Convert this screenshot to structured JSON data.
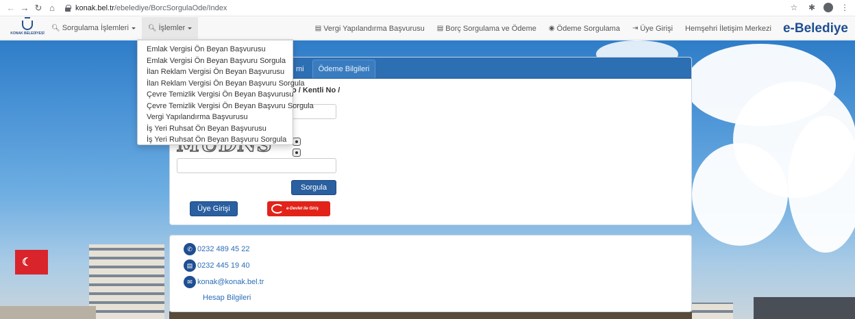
{
  "browser": {
    "url_host": "konak.bel.tr",
    "url_path": "/ebelediye/BorcSorgulaOde/Index",
    "icons": [
      "back-arrow-icon",
      "forward-arrow-icon",
      "reload-icon",
      "home-icon",
      "lock-icon",
      "star-icon",
      "extensions-icon",
      "profile-icon",
      "menu-icon"
    ]
  },
  "navbar": {
    "logo_text": "KONAK BELEDİYESİ",
    "menu_sorgulama": "Sorgulama İşlemleri",
    "menu_islemler": "İşlemler",
    "link_vergi": "Vergi Yapılandırma Başvurusu",
    "link_borc": "Borç Sorgulama ve Ödeme",
    "link_odeme_sorgulama": "Ödeme Sorgulama",
    "link_uye_girisi": "Üye Girişi",
    "link_hemsehri": "Hemşehri İletişim Merkezi",
    "brand": "e-Belediye"
  },
  "dropdown": {
    "items": [
      "Emlak Vergisi Ön Beyan Başvurusu",
      "Emlak Vergisi Ön Beyan Başvuru Sorgula",
      "İlan Reklam Vergisi Ön Beyan Başvurusu",
      "İlan Reklam Vergisi Ön Beyan Başvuru Sorgula",
      "Çevre Temizlik Vergisi Ön Beyan Başvurusu",
      "Çevre Temizlik Vergisi Ön Beyan Başvuru Sorgula",
      "Vergi Yapılandırma Başvurusu",
      "İş Yeri Ruhsat Ön Beyan Başvurusu",
      "İş Yeri Ruhsat Ön Beyan Başvuru Sorgula"
    ]
  },
  "panel": {
    "tab_partial": "mi",
    "tab_odeme": "Ödeme Bilgileri",
    "form_label_partial": "o / Kentli No /",
    "captcha_text": "MUDNS",
    "sorgula_button": "Sorgula",
    "uye_girisi_button": "Üye Girişi",
    "edevlet_button": "e-Devlet ile Giriş"
  },
  "contact": {
    "phone": "0232 489 45 22",
    "fax": "0232 445 19 40",
    "email": "konak@konak.bel.tr",
    "hesap": "Hesap Bilgileri"
  },
  "colors": {
    "brand": "#1f4e92",
    "panel_header": "#2d6fb3",
    "primary_button": "#2a5fa0",
    "edevlet_red": "#e2231a",
    "link": "#2a6db5"
  }
}
